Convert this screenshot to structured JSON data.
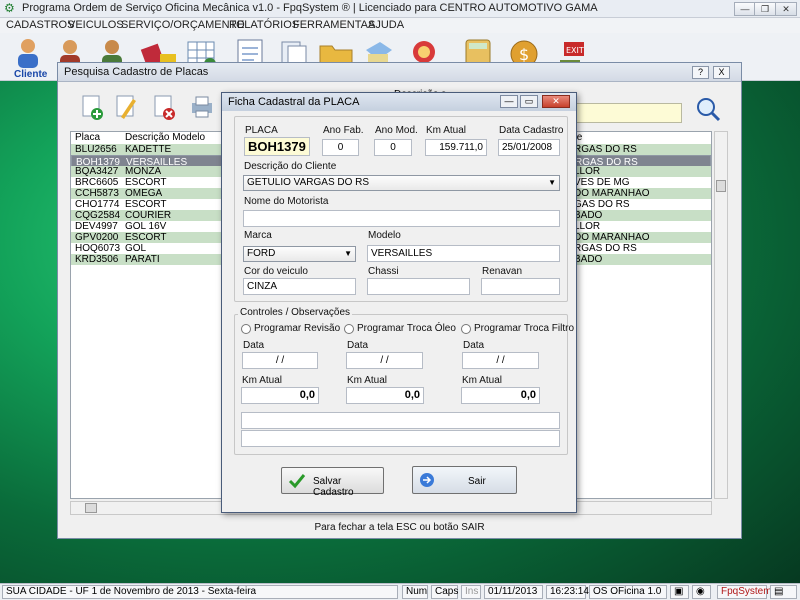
{
  "app": {
    "title": "Programa Ordem de Serviço Oficina Mecânica v1.0 - FpqSystem ® | Licenciado para  CENTRO AUTOMOTIVO GAMA"
  },
  "menu": [
    "CADASTROS",
    "VEICULOS",
    "SERVIÇO/ORÇAMENTO",
    "RELATÓRIOS",
    "FERRAMENTAS",
    "AJUDA"
  ],
  "toolbar": {
    "first_label": "Cliente"
  },
  "search_window": {
    "title": "Pesquisa Cadastro de Placas",
    "help": "?",
    "close": "X",
    "partial_label": "Descrição s",
    "columns": [
      "Placa",
      "Descrição Modelo",
      "te"
    ],
    "rows": [
      {
        "placa": "BLU2656",
        "modelo": "KADETTE",
        "cliente": "RGAS DO RS"
      },
      {
        "placa": "BOH1379",
        "modelo": "VERSAILLES",
        "cliente": "RGAS DO RS"
      },
      {
        "placa": "BQA3427",
        "modelo": "MONZA",
        "cliente": "LLOR"
      },
      {
        "placa": "BRC6605",
        "modelo": "ESCORT",
        "cliente": "VES DE MG"
      },
      {
        "placa": "CCH5873",
        "modelo": "OMEGA",
        "cliente": "DO MARANHAO"
      },
      {
        "placa": "CHO1774",
        "modelo": "ESCORT",
        "cliente": "GAS DO RS"
      },
      {
        "placa": "CQG2584",
        "modelo": "COURIER",
        "cliente": "BADO"
      },
      {
        "placa": "DEV4997",
        "modelo": "GOL 16V",
        "cliente": "LLOR"
      },
      {
        "placa": "GPV0200",
        "modelo": "ESCORT",
        "cliente": "DO MARANHAO"
      },
      {
        "placa": "HOQ6073",
        "modelo": "GOL",
        "cliente": "RGAS DO RS"
      },
      {
        "placa": "KRD3506",
        "modelo": "PARATI",
        "cliente": "BADO"
      }
    ],
    "hint": "Para fechar a tela ESC ou botão SAIR"
  },
  "ficha": {
    "title": "Ficha Cadastral da PLACA",
    "labels": {
      "placa": "PLACA",
      "ano_fab": "Ano Fab.",
      "ano_mod": "Ano Mod.",
      "km_atual": "Km Atual",
      "data_cadastro": "Data Cadastro",
      "cliente": "Descrição do Cliente",
      "motorista": "Nome do Motorista",
      "marca": "Marca",
      "modelo": "Modelo",
      "cor": "Cor do veiculo",
      "chassi": "Chassi",
      "renavan": "Renavan",
      "controles": "Controles / Observações",
      "data": "Data",
      "km": "Km Atual"
    },
    "values": {
      "placa": "BOH1379",
      "ano_fab": "0",
      "ano_mod": "0",
      "km_atual": "159.711,0",
      "data_cadastro": "25/01/2008",
      "cliente": "GETULIO VARGAS DO RS",
      "motorista": "",
      "marca": "FORD",
      "modelo": "VERSAILLES",
      "cor": "CINZA",
      "chassi": "",
      "renavan": ""
    },
    "programs": [
      {
        "label": "Programar Revisão",
        "date": " /  /",
        "km": "0,0"
      },
      {
        "label": "Programar Troca Óleo",
        "date": " /  /",
        "km": "0,0"
      },
      {
        "label": "Programar Troca Filtro",
        "date": " /  /",
        "km": "0,0"
      }
    ],
    "save_label": "Salvar Cadastro",
    "exit_label": "Sair"
  },
  "status": {
    "location": "SUA CIDADE - UF  1 de Novembro de 2013 - Sexta-feira",
    "num": "Num",
    "caps": "Caps",
    "ins": "Ins",
    "date": "01/11/2013",
    "time": "16:23:14",
    "module": "OS OFicina 1.0",
    "brand": "FpqSystem"
  },
  "colors": {
    "accent_green": "#c8dfc6",
    "selected_row": "#7f8490",
    "search_field": "#fdfbd6"
  }
}
